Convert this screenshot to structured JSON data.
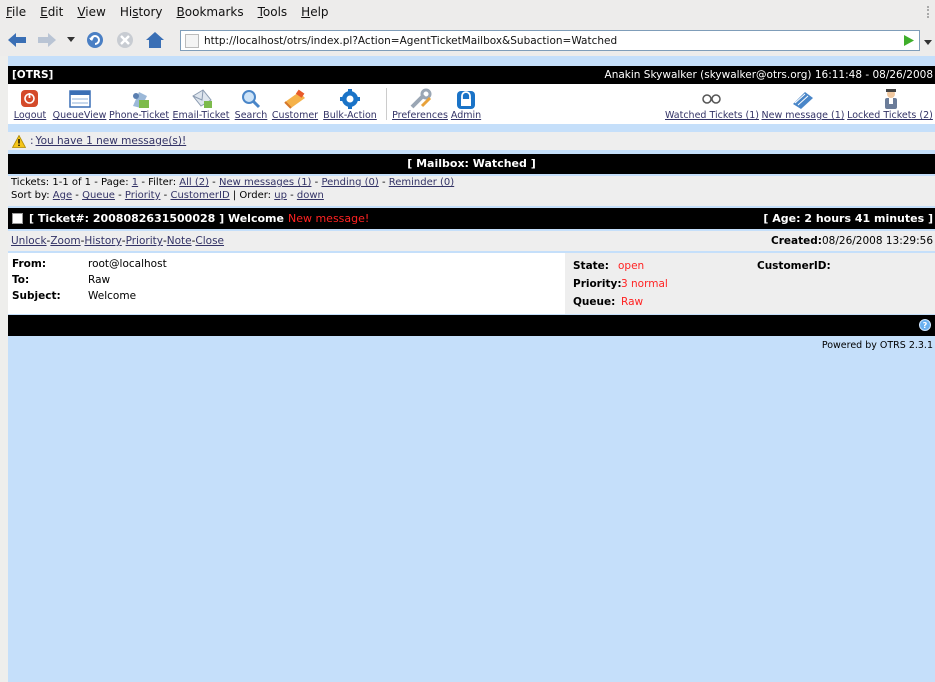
{
  "browser": {
    "menu": [
      {
        "acc": "F",
        "rest": "ile"
      },
      {
        "acc": "E",
        "rest": "dit"
      },
      {
        "acc": "V",
        "rest": "iew"
      },
      {
        "pre": "Hi",
        "acc": "s",
        "rest": "tory"
      },
      {
        "acc": "B",
        "rest": "ookmarks"
      },
      {
        "acc": "T",
        "rest": "ools"
      },
      {
        "acc": "H",
        "rest": "elp"
      }
    ],
    "url": "http://localhost/otrs/index.pl?Action=AgentTicketMailbox&Subaction=Watched"
  },
  "header": {
    "brand": "[OTRS]",
    "user_info": "Anakin Skywalker (skywalker@otrs.org) 16:11:48 - 08/26/2008"
  },
  "toolbar": {
    "logout": "Logout",
    "queue_view": "QueueView",
    "phone_ticket": "Phone-Ticket",
    "email_ticket": "Email-Ticket",
    "search": "Search",
    "customer": "Customer",
    "bulk_action": "Bulk-Action",
    "preferences": "Preferences",
    "admin": "Admin",
    "watched": "Watched Tickets (1)",
    "new_message": "New message (1)",
    "locked": "Locked Tickets (2)"
  },
  "notification": {
    "colon": ":",
    "text": "You have 1 new message(s)!"
  },
  "mailbox": {
    "title": "[ Mailbox: Watched ]"
  },
  "filter": {
    "tickets_prefix": "Tickets: 1-1 of 1 - Page: ",
    "page": "1",
    "filter_label": " - Filter: ",
    "all": "All (2)",
    "new_messages": "New messages (1)",
    "pending": "Pending (0)",
    "reminder": "Reminder (0)",
    "sort_label": "Sort by: ",
    "sort_age": "Age",
    "sort_queue": "Queue",
    "sort_priority": "Priority",
    "sort_customerid": "CustomerID",
    "order_label": " | Order: ",
    "order_up": "up",
    "order_down": "down"
  },
  "ticket": {
    "title": "[ Ticket#: 2008082631500028 ] Welcome",
    "new_message": "New message!",
    "age": "[ Age: 2 hours 41 minutes ]",
    "actions": {
      "unlock": "Unlock",
      "zoom": "Zoom",
      "history": "History",
      "priority": "Priority",
      "note": "Note",
      "close": "Close"
    },
    "created_label": "Created:",
    "created_value": "08/26/2008 13:29:56",
    "from_label": "From:",
    "from_value": "root@localhost",
    "to_label": "To:",
    "to_value": "Raw",
    "subject_label": "Subject:",
    "subject_value": "Welcome",
    "state_label": "State:",
    "state_value": "open",
    "priority_label": "Priority:",
    "priority_value": "3 normal",
    "queue_label": "Queue:",
    "queue_value": "Raw",
    "customerid_label": "CustomerID:"
  },
  "footer": {
    "help": "?",
    "powered": "Powered by OTRS 2.3.1"
  },
  "colors": {
    "page_background": "#c5dffa",
    "bar_black": "#000000",
    "link": "#333366",
    "alert_red": "#ff2222"
  }
}
